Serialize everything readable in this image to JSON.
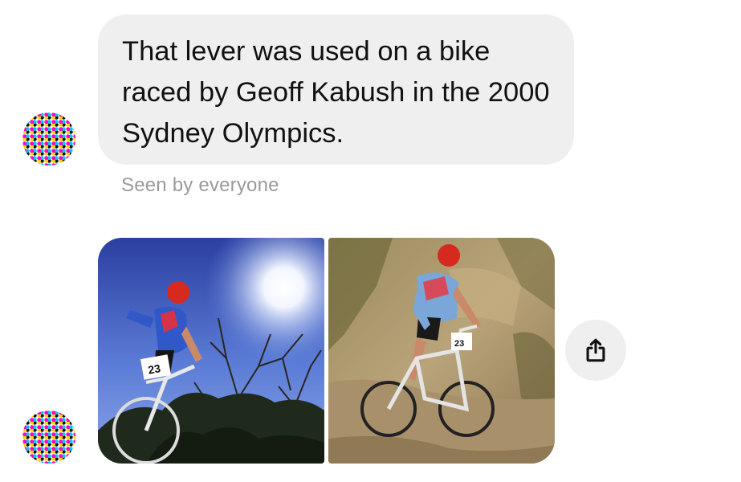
{
  "thread": {
    "message_text": "That lever was used on a bike raced by Geoff Kabush in the 2000 Sydney Olympics.",
    "seen_status": "Seen by everyone"
  },
  "photos": [
    {
      "icon": "photo-cyclist-sky",
      "bib_number": "23"
    },
    {
      "icon": "photo-cyclist-rocks",
      "bib_number": "23"
    }
  ],
  "actions": {
    "share_icon": "share-icon"
  },
  "colors": {
    "bubble_bg": "#efefef",
    "text": "#111111",
    "meta_text": "#9a9a9a",
    "page_bg": "#ffffff"
  }
}
